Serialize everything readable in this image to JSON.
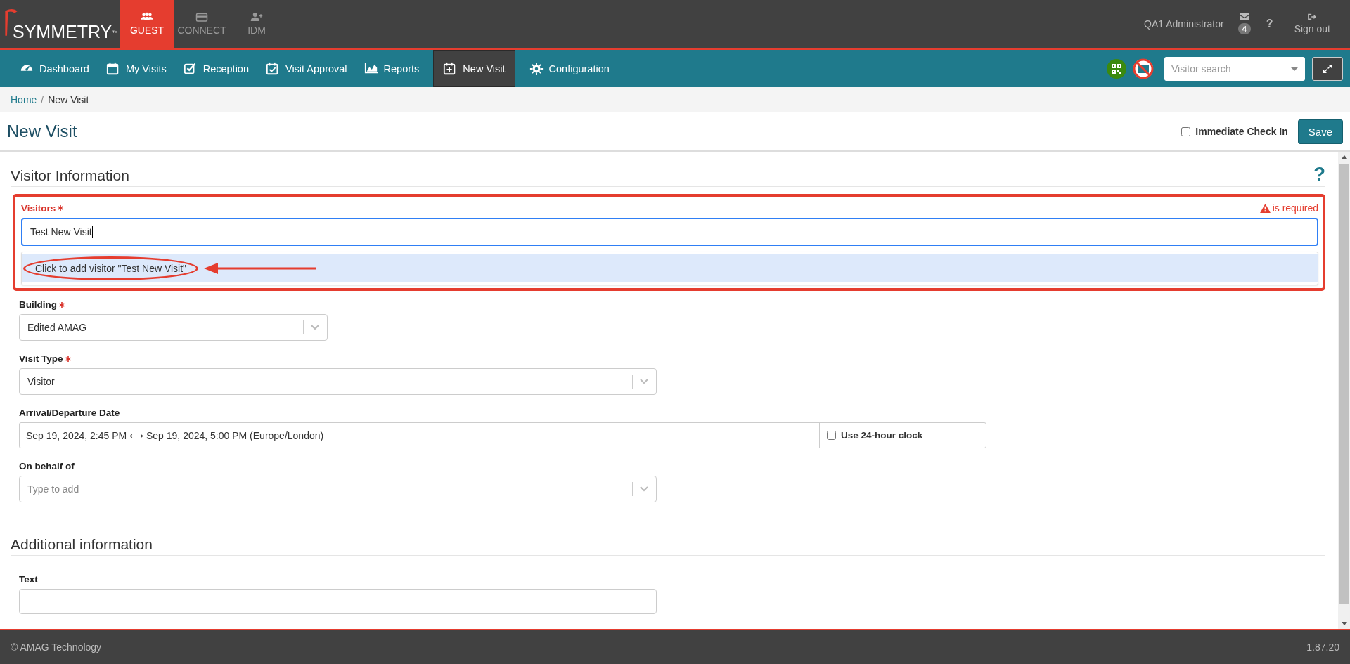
{
  "brand": {
    "name": "SYMMETRY",
    "mark": "™"
  },
  "modules": [
    {
      "label": "GUEST",
      "selected": true
    },
    {
      "label": "CONNECT",
      "selected": false
    },
    {
      "label": "IDM",
      "selected": false
    }
  ],
  "user": {
    "name": "QA1 Administrator",
    "messages": "4",
    "help": "?",
    "sign_out": "Sign out"
  },
  "nav": [
    {
      "label": "Dashboard",
      "selected": false
    },
    {
      "label": "My Visits",
      "selected": false
    },
    {
      "label": "Reception",
      "selected": false
    },
    {
      "label": "Visit Approval",
      "selected": false
    },
    {
      "label": "Reports",
      "selected": false
    },
    {
      "label": "New Visit",
      "selected": true
    },
    {
      "label": "Configuration",
      "selected": false
    }
  ],
  "visitor_search": {
    "placeholder": "Visitor search"
  },
  "breadcrumb": [
    {
      "label": "Home",
      "kind": "link"
    },
    {
      "label": "/",
      "kind": "separator"
    },
    {
      "label": "New Visit",
      "kind": "current"
    }
  ],
  "page": {
    "title": "New Visit",
    "immediate_check_in": {
      "label": "Immediate Check In",
      "checked": false
    },
    "save": "Save"
  },
  "sections": [
    {
      "title": "Visitor Information",
      "help": "?",
      "fields": [
        {
          "kind": "typeahead",
          "label": "Visitors",
          "required": true,
          "error": "is required",
          "value": "Test New Visit",
          "suggestion": "Click to add visitor \"Test New Visit\"",
          "annotated": true
        },
        {
          "kind": "select",
          "label": "Building",
          "required": true,
          "value": "Edited AMAG"
        },
        {
          "kind": "select",
          "label": "Visit Type",
          "required": true,
          "value": "Visitor"
        },
        {
          "kind": "daterange",
          "label": "Arrival/Departure Date",
          "required": false,
          "value": "Sep 19, 2024, 2:45 PM ⟷ Sep 19, 2024, 5:00 PM (Europe/London)",
          "clock": {
            "label": "Use 24-hour clock",
            "checked": false
          }
        },
        {
          "kind": "select",
          "label": "On behalf of",
          "required": false,
          "placeholder": "Type to add"
        }
      ]
    },
    {
      "title": "Additional information",
      "fields": [
        {
          "kind": "text",
          "label": "Text",
          "required": false
        }
      ]
    }
  ],
  "footer": {
    "copyright": "© AMAG Technology",
    "version": "1.87.20"
  }
}
